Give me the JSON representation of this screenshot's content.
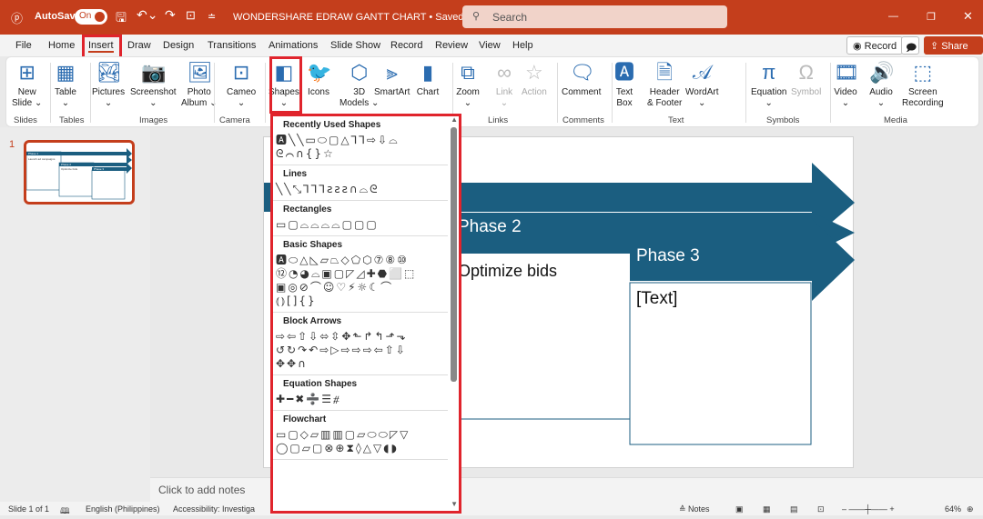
{
  "titlebar": {
    "autosave": "AutoSave",
    "toggle": "On",
    "doc_title": "WONDERSHARE EDRAW GANTT CHART • Saved ⌄",
    "search_placeholder": "Search",
    "accent": "#c43e1c"
  },
  "tabs": [
    "File",
    "Home",
    "Insert",
    "Draw",
    "Design",
    "Transitions",
    "Animations",
    "Slide Show",
    "Record",
    "Review",
    "View",
    "Help"
  ],
  "active_tab": "Insert",
  "right_buttons": {
    "record": "◉ Record",
    "share": "Share"
  },
  "ribbon": {
    "buttons": [
      {
        "label": "New\nSlide ⌄",
        "icon": "new-slide-icon"
      },
      {
        "label": "Table\n⌄",
        "icon": "table-icon"
      },
      {
        "label": "Pictures\n⌄",
        "icon": "pictures-icon"
      },
      {
        "label": "Screenshot\n⌄",
        "icon": "screenshot-icon"
      },
      {
        "label": "Photo\nAlbum ⌄",
        "icon": "photo-album-icon"
      },
      {
        "label": "Cameo\n⌄",
        "icon": "cameo-icon"
      },
      {
        "label": "Shapes\n⌄",
        "icon": "shapes-icon"
      },
      {
        "label": "Icons",
        "icon": "icons-icon"
      },
      {
        "label": "3D\nModels ⌄",
        "icon": "3d-models-icon"
      },
      {
        "label": "SmartArt",
        "icon": "smartart-icon"
      },
      {
        "label": "Chart",
        "icon": "chart-icon"
      },
      {
        "label": "Zoom\n⌄",
        "icon": "zoom-icon"
      },
      {
        "label": "Link\n⌄",
        "icon": "link-icon"
      },
      {
        "label": "Action",
        "icon": "action-icon"
      },
      {
        "label": "Comment",
        "icon": "comment-icon"
      },
      {
        "label": "Text\nBox",
        "icon": "text-box-icon"
      },
      {
        "label": "Header\n& Footer",
        "icon": "header-footer-icon"
      },
      {
        "label": "WordArt\n⌄",
        "icon": "wordart-icon"
      },
      {
        "label": "Equation\n⌄",
        "icon": "equation-icon"
      },
      {
        "label": "Symbol",
        "icon": "symbol-icon"
      },
      {
        "label": "Video\n⌄",
        "icon": "video-icon"
      },
      {
        "label": "Audio\n⌄",
        "icon": "audio-icon"
      },
      {
        "label": "Screen\nRecording",
        "icon": "screen-recording-icon"
      }
    ],
    "groups": [
      "Slides",
      "Tables",
      "Images",
      "Camera",
      "Links",
      "Comments",
      "Text",
      "Symbols",
      "Media"
    ]
  },
  "dropdown": {
    "sections": [
      {
        "title": "Recently Used Shapes",
        "rows": [
          "🅰╲╲▭⬭▢△⅂⅂⇨⇩⌓",
          "ᘓ⌒∩{}☆"
        ]
      },
      {
        "title": "Lines",
        "rows": [
          "╲╲⤡⅂⅂⅂ƨƨƨ∩⌓ᘓ"
        ]
      },
      {
        "title": "Rectangles",
        "rows": [
          "▭▢⌓⌓⌓⌓▢▢▢"
        ]
      },
      {
        "title": "Basic Shapes",
        "rows": [
          "🅰⬭△◺▱⏢◇⬠⬡⑦⑧⑩",
          "⑫◔◕⌓▣▢◸◿✚⬣⬜⬚",
          "▣◎⊘⌒☺♡⚡☼☾⌒",
          "⦅⦆[]{}"
        ]
      },
      {
        "title": "Block Arrows",
        "rows": [
          "⇨⇦⇧⇩⬄⇳✥⬑↱↰⬏⬎",
          "↺↻↷↶⇨▷⇨⇨⇨⇦⇧⇩",
          "✥✥∩"
        ]
      },
      {
        "title": "Equation Shapes",
        "rows": [
          "✚━✖➗☰⧣"
        ]
      },
      {
        "title": "Flowchart",
        "rows": [
          "▭▢◇▱▥▥▢▱⬭⬭◸▽",
          "◯▢▱▢⊗⊕⧗◊△▽◖◗"
        ]
      }
    ]
  },
  "thumbnail": {
    "number": "1",
    "phase1": "Phase 1",
    "phase1_text": "Launch ad campaigns",
    "phase2": "Phase 2",
    "phase2_text": "Optimize bids",
    "phase3": "Phase 3"
  },
  "slide": {
    "phase2": "Phase 2",
    "phase2_text": "Optimize bids",
    "phase3": "Phase 3",
    "phase3_text": "[Text]",
    "arrow_color": "#1b5e80"
  },
  "notes_placeholder": "Click to add notes",
  "status": {
    "slide": "Slide 1 of 1",
    "language": "English (Philippines)",
    "accessibility": "Accessibility: Investiga",
    "notes": "≙ Notes",
    "zoom": "64%"
  }
}
